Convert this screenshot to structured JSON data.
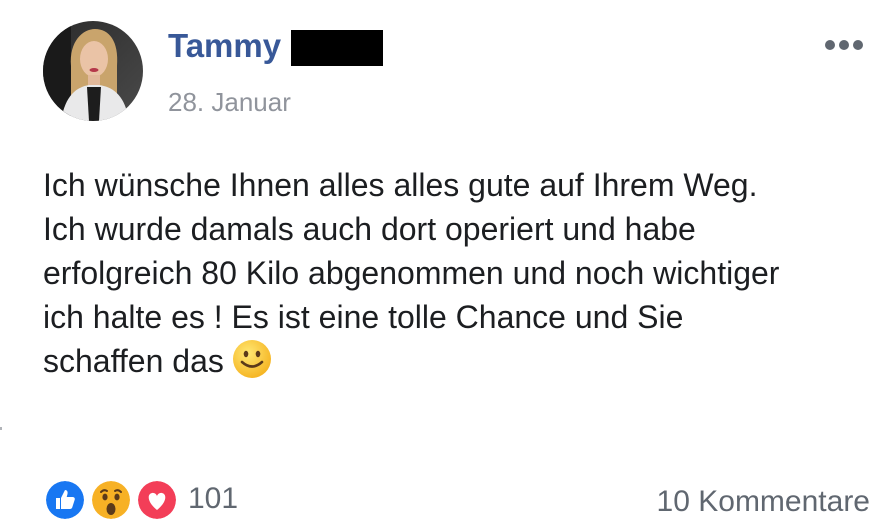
{
  "post": {
    "author": "Tammy",
    "date": "28. Januar",
    "text_lines": [
      "Ich wünsche Ihnen alles alles gute auf Ihrem Weg.",
      "Ich wurde damals auch dort operiert und habe",
      "erfolgreich 80 Kilo abgenommen und noch wichtiger",
      "ich halte es ! Es ist eine tolle Chance und Sie",
      "schaffen das"
    ],
    "emoji": "slightly-smiling-face"
  },
  "icons": {
    "more": "more-horizontal-icon",
    "reactions": [
      "like-icon",
      "wow-icon",
      "love-icon"
    ]
  },
  "footer": {
    "reaction_count": "101",
    "comments": "10 Kommentare"
  },
  "colors": {
    "author": "#385898",
    "meta": "#90949c",
    "text": "#1c1e21",
    "like": "#1877f2",
    "love": "#f33e58",
    "wow": "#f7b125"
  }
}
